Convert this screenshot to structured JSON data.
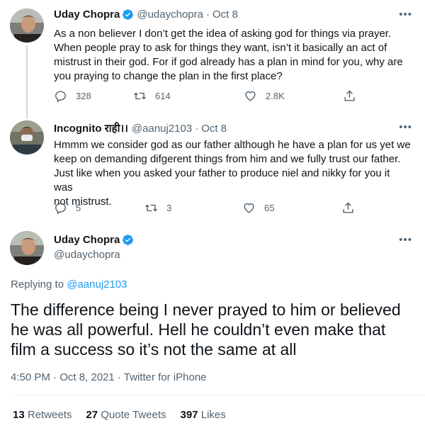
{
  "tweet1": {
    "name": "Uday Chopra",
    "handle": "@udaychopra",
    "dot": "·",
    "date": "Oct 8",
    "more": "•••",
    "lines": [
      "As a non believer I don’t get the idea of asking god for things via prayer.",
      "When people pray to ask for things they want, isn’t it basically an act of",
      "mistrust in their god. For if god already has a plan in mind for you, why are",
      "you praying to change the plan in the first place?"
    ],
    "replies": "328",
    "retweets": "614",
    "likes": "2.8K"
  },
  "tweet2": {
    "name": "Incognito राही।।",
    "handle": "@aanuj2103",
    "dot": "·",
    "date": "Oct 8",
    "more": "•••",
    "lines": [
      "Hmmm we consider god as our father although he have a plan for us yet we",
      "keep on demanding difgerent things from him and we fully trust our father.",
      "Just like when you asked your father to produce niel and nikky for you it was",
      "not mistrust."
    ],
    "replies": "5",
    "retweets": "3",
    "likes": "65"
  },
  "main": {
    "name": "Uday Chopra",
    "handle": "@udaychopra",
    "more": "•••",
    "replying_prefix": "Replying to",
    "replying_to": "@aanuj2103",
    "lines": [
      "The difference being I never prayed to him or believed",
      "he was all powerful. Hell he couldn’t even make that",
      "film a success so it’s not the same at all"
    ],
    "meta": "4:50 PM · Oct 8, 2021 · Twitter for iPhone",
    "retweets_count": "13",
    "retweets_label": "Retweets",
    "quotes_count": "27",
    "quotes_label": "Quote Tweets",
    "likes_count": "397",
    "likes_label": "Likes"
  },
  "colors": {
    "verified": "#1d9bf0",
    "link": "#1d9bf0",
    "secondary_text": "#536471"
  }
}
